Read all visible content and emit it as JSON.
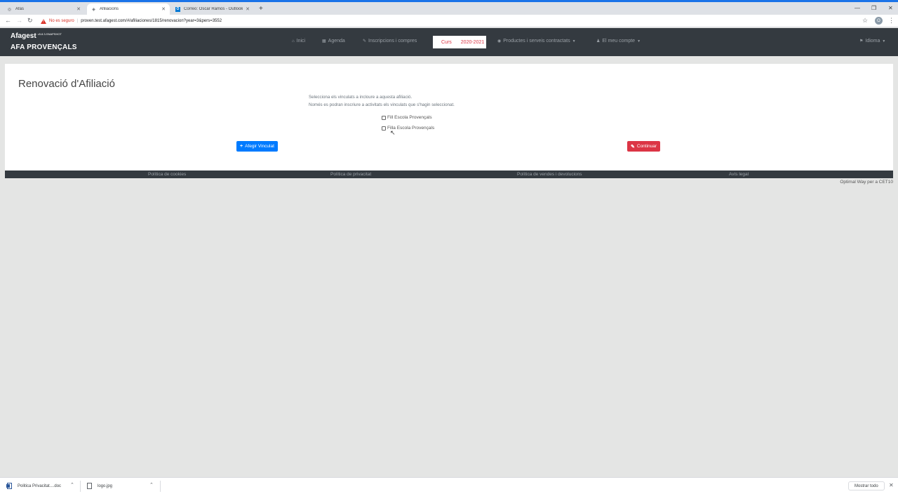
{
  "browser": {
    "tabs": [
      {
        "title": "Afas",
        "active": false
      },
      {
        "title": "Afiliacions",
        "active": true
      },
      {
        "title": "Correo: Oscar Ramos - Outlook",
        "active": false
      }
    ],
    "new_tab": "+",
    "not_secure_label": "No es seguro",
    "url": "proven.test.afagest.com/#/afiliaciones/1815/renovacion?year=3&pers=3552",
    "profile_initial": "O"
  },
  "app": {
    "brand_name": "Afagest",
    "brand_version": "v5.8.3-SNAPSHOT",
    "org_name": "AFA PROVENÇALS",
    "nav": {
      "inici": "Inici",
      "agenda": "Agenda",
      "inscripcions": "Inscripcions i compres",
      "course_label": "Curs",
      "course_year": "2020-2021",
      "productes": "Productes i serveis contractats",
      "compte": "El meu compte",
      "idioma": "Idioma"
    }
  },
  "main": {
    "title": "Renovació d'Afiliació",
    "help_line1": "Selecciona els vinculats a incloure a aquesta afiliació.",
    "help_line2": "Només es podran inscriure a activitats els vinculats que s'hagin seleccionat.",
    "checkboxes": [
      {
        "label": "Fill Escola Provençals",
        "checked": false
      },
      {
        "label": "Filla Escola Provençals",
        "checked": false
      }
    ],
    "add_button": "Afegir Vinculat",
    "continue_button": "Continuar"
  },
  "footer": {
    "cookies": "Política de cookies",
    "privacy": "Política de privacitat",
    "sales": "Política de vendes i devolucions",
    "legal": "Avís legal",
    "credits": "Optimal Way per a CET10"
  },
  "downloads": {
    "items": [
      {
        "name": "Politica Privacitat....doc"
      },
      {
        "name": "logo.jpg"
      }
    ],
    "show_all": "Mostrar todo"
  }
}
